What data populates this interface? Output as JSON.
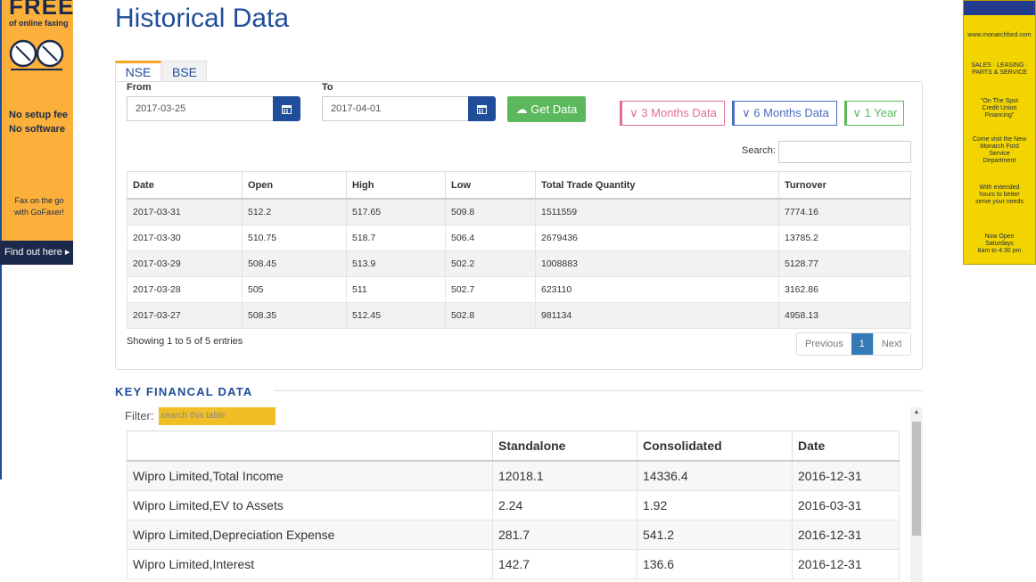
{
  "page": {
    "title": "Historical Data"
  },
  "ad_left": {
    "headline": "FREE",
    "subheadline": "of online faxing",
    "line1": "No setup fee",
    "line2": "No software",
    "line3": "Fax on the go",
    "line4": "with GoFaxer!",
    "cta": "Find out here"
  },
  "ad_right": {
    "url": "www.monarchford.com",
    "l1": "SALES · LEASING ·",
    "l2": "PARTS & SERVICE",
    "l3": "\"On The Spot",
    "l4": "Credit Union",
    "l5": "Financing\"",
    "l6": "Come visit the New",
    "l7": "Monarch Ford",
    "l8": "Service",
    "l9": "Department",
    "l10": "With extended",
    "l11": "hours to better",
    "l12": "serve your needs",
    "l13": "Now Open",
    "l14": "Saturdays",
    "l15": "8am to 4:30 pm"
  },
  "tabs": {
    "nse": "NSE",
    "bse": "BSE"
  },
  "form": {
    "from_label": "From",
    "from_value": "2017-03-25",
    "to_label": "To",
    "to_value": "2017-04-01",
    "get_data": "Get Data",
    "btn_3m": "3 Months Data",
    "btn_6m": "6 Months Data",
    "btn_1y": "1 Year",
    "search_label": "Search:"
  },
  "hist_table": {
    "headers": [
      "Date",
      "Open",
      "High",
      "Low",
      "Total Trade Quantity",
      "Turnover"
    ],
    "rows": [
      [
        "2017-03-31",
        "512.2",
        "517.65",
        "509.8",
        "1511559",
        "7774.16"
      ],
      [
        "2017-03-30",
        "510.75",
        "518.7",
        "506.4",
        "2679436",
        "13785.2"
      ],
      [
        "2017-03-29",
        "508.45",
        "513.9",
        "502.2",
        "1008883",
        "5128.77"
      ],
      [
        "2017-03-28",
        "505",
        "511",
        "502.7",
        "623110",
        "3162.86"
      ],
      [
        "2017-03-27",
        "508.35",
        "512.45",
        "502.8",
        "981134",
        "4958.13"
      ]
    ]
  },
  "pagination": {
    "showing": "Showing 1 to 5 of 5 entries",
    "previous": "Previous",
    "current": "1",
    "next": "Next"
  },
  "kfd": {
    "title": "KEY FINANCAL DATA",
    "filter_label": "Filter:",
    "filter_placeholder": "search this table",
    "headers": [
      "",
      "Standalone",
      "Consolidated",
      "Date"
    ],
    "rows": [
      [
        "Wipro Limited,Total Income",
        "12018.1",
        "14336.4",
        "2016-12-31"
      ],
      [
        "Wipro Limited,EV to Assets",
        "2.24",
        "1.92",
        "2016-03-31"
      ],
      [
        "Wipro Limited,Depreciation Expense",
        "281.7",
        "541.2",
        "2016-12-31"
      ],
      [
        "Wipro Limited,Interest",
        "142.7",
        "136.6",
        "2016-12-31"
      ]
    ]
  },
  "colors": {
    "brand_blue": "#1f4d9a",
    "green": "#5cb85c",
    "pink": "#e06b9a",
    "active_page": "#337ab7",
    "filter_bg": "#f0be25"
  }
}
